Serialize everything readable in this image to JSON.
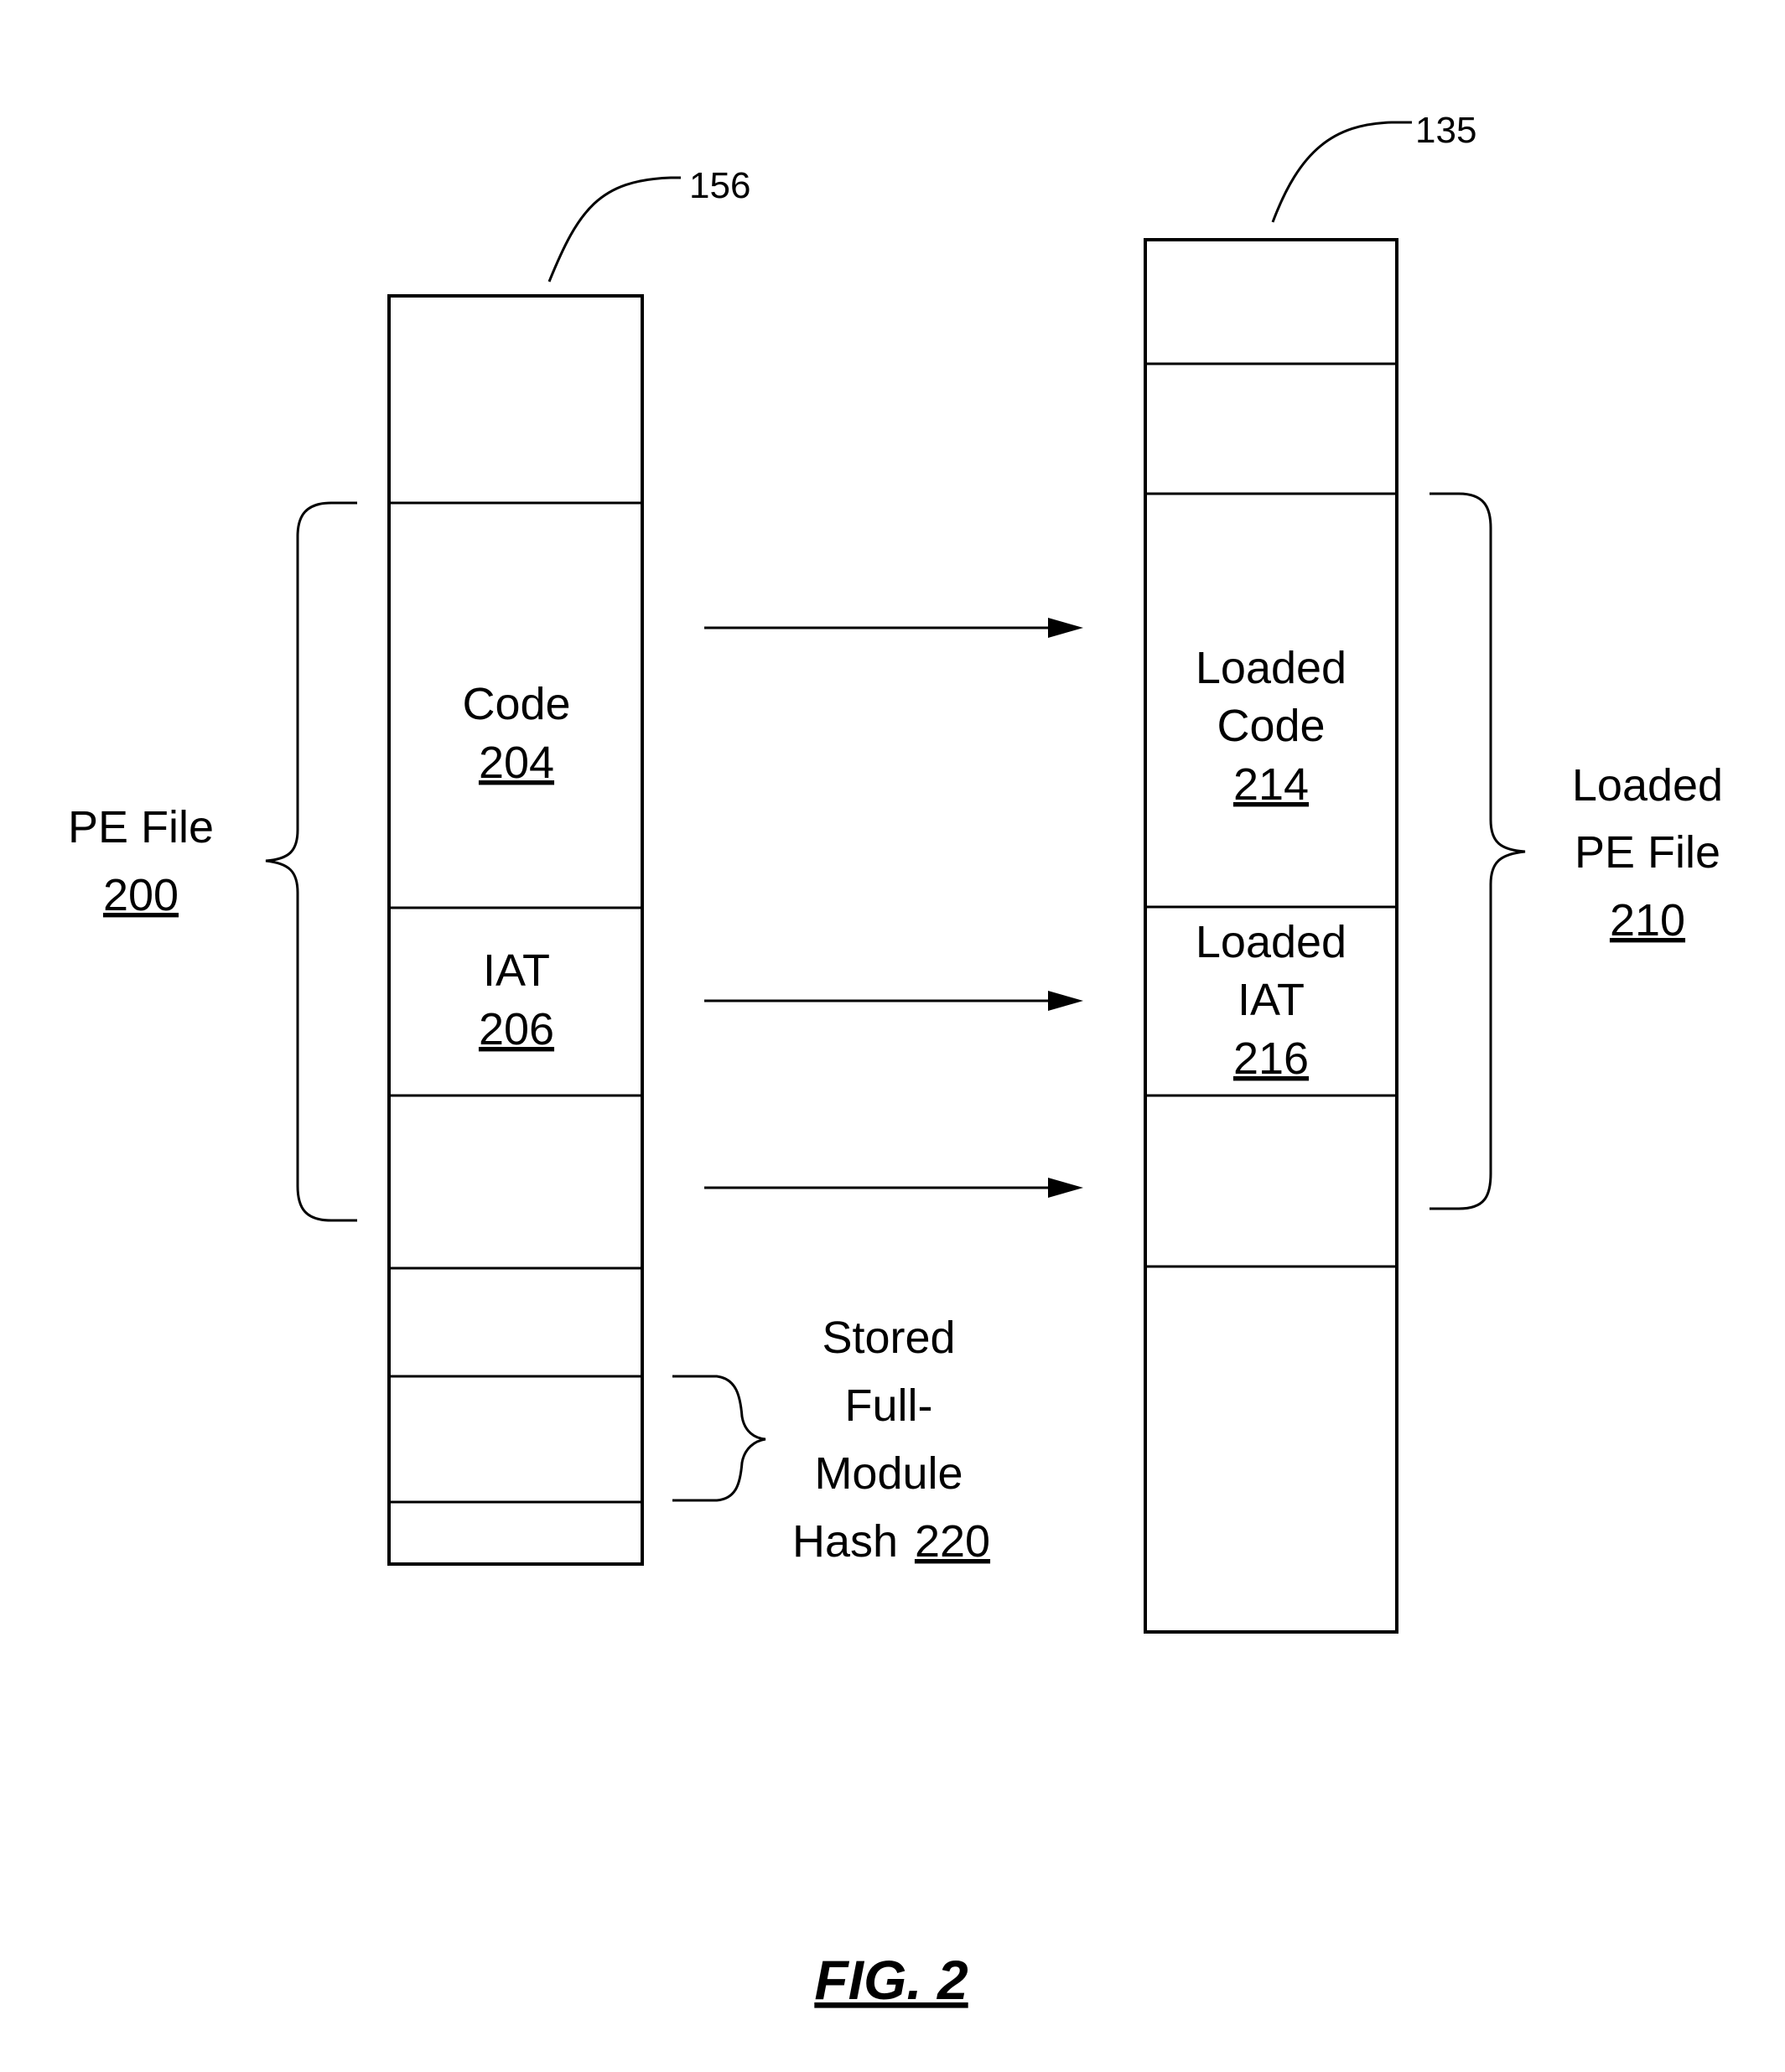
{
  "figure": {
    "caption": "FIG. 2",
    "left_module": {
      "ref": "156",
      "sections": [
        {
          "title": "",
          "ref": ""
        },
        {
          "title": "Code",
          "ref": "204"
        },
        {
          "title": "IAT",
          "ref": "206"
        },
        {
          "title": "",
          "ref": ""
        },
        {
          "title": "",
          "ref": ""
        },
        {
          "title": "",
          "ref": ""
        },
        {
          "title": "",
          "ref": ""
        }
      ],
      "group_label": {
        "title": "PE File",
        "ref": "200"
      },
      "hash_label": {
        "line1": "Stored",
        "line2": "Full-",
        "line3": "Module",
        "line4": "Hash",
        "ref": "220"
      }
    },
    "right_module": {
      "ref": "135",
      "sections": [
        {
          "title": "",
          "ref": ""
        },
        {
          "title": "",
          "ref": ""
        },
        {
          "line1": "Loaded",
          "line2": "Code",
          "ref": "214"
        },
        {
          "line1": "Loaded",
          "line2": "IAT",
          "ref": "216"
        },
        {
          "title": "",
          "ref": ""
        },
        {
          "title": "",
          "ref": ""
        }
      ],
      "group_label": {
        "line1": "Loaded",
        "line2": "PE File",
        "ref": "210"
      }
    },
    "arrows": [
      {
        "from": "Code 204",
        "to": "Loaded Code 214"
      },
      {
        "from": "IAT 206",
        "to": "Loaded IAT 216"
      },
      {
        "from": "section below IAT 206",
        "to": "section below Loaded IAT 216"
      }
    ]
  }
}
